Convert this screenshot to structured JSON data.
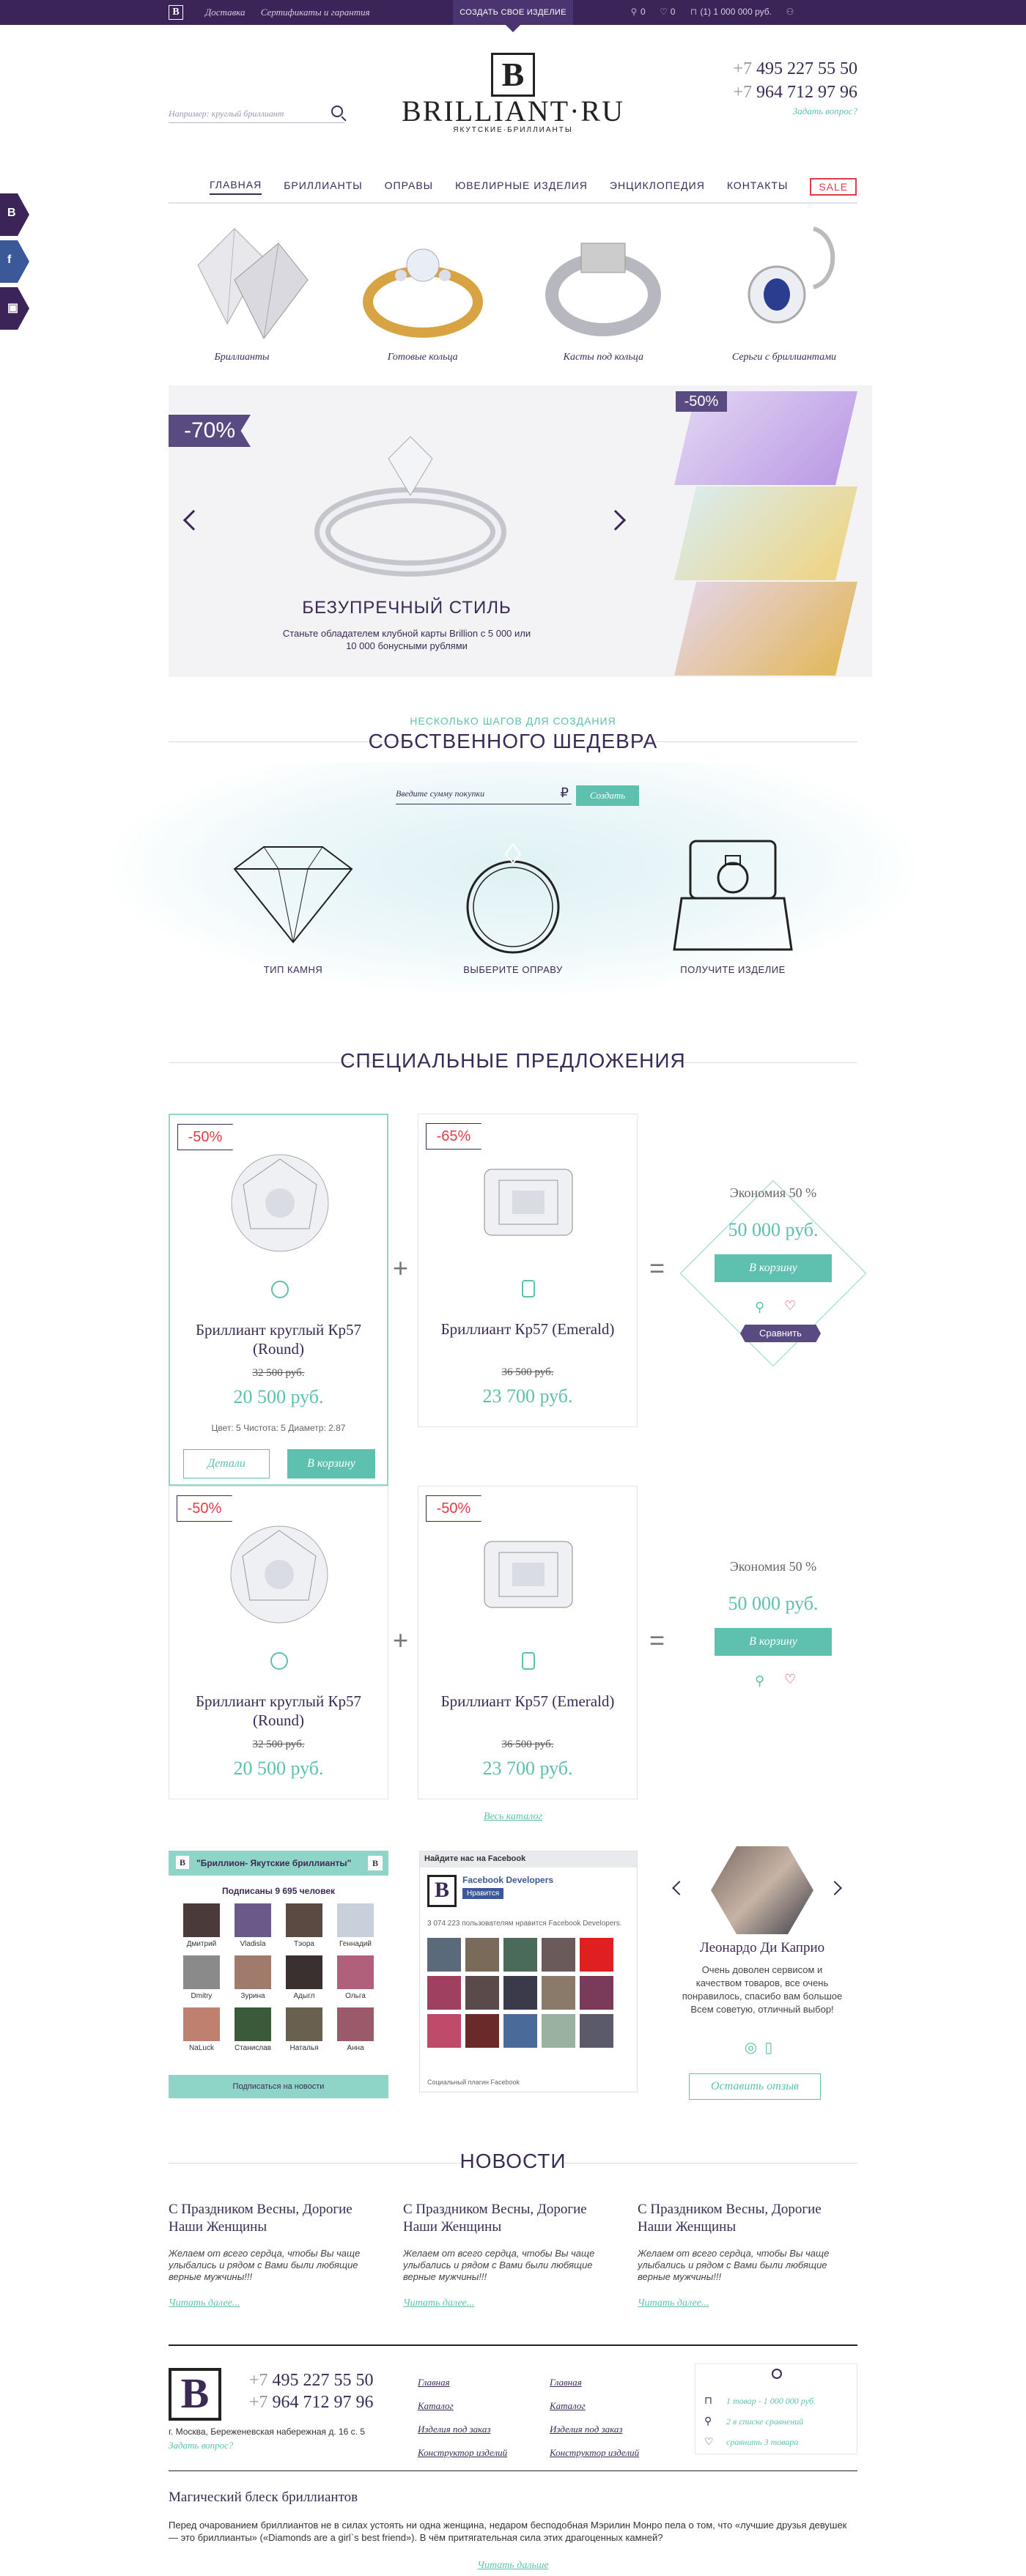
{
  "topbar": {
    "logo": "B",
    "links": [
      "Доставка",
      "Сертификаты и гарантия"
    ],
    "create": "СОЗДАТЬ СВОЕ ИЗДЕЛИЕ",
    "compare_count": "0",
    "fav_count": "0",
    "cart": "(1)   1 000 000 руб."
  },
  "header": {
    "search_placeholder": "Например: круглый бриллиант",
    "brand_mono": "B",
    "brand_name": "BRILLIANT·RU",
    "brand_tagline": "ЯКУТСКИЕ·БРИЛЛИАНТЫ",
    "phone1_prefix": "+7",
    "phone1": "495 227 55 50",
    "phone2_prefix": "+7",
    "phone2": "964 712 97 96",
    "ask": "Задать вопрос?"
  },
  "nav": [
    "ГЛАВНАЯ",
    "БРИЛЛИАНТЫ",
    "ОПРАВЫ",
    "ЮВЕЛИРНЫЕ ИЗДЕЛИЯ",
    "ЭНЦИКЛОПЕДИЯ",
    "КОНТАКТЫ",
    "SALE"
  ],
  "social": [
    "B",
    "f",
    "▣"
  ],
  "categories": [
    "Бриллианты",
    "Готовые кольца",
    "Касты под кольца",
    "Серьги с бриллиантами"
  ],
  "banner": {
    "badge": "-70%",
    "title": "БЕЗУПРЕЧНЫЙ СТИЛЬ",
    "subtitle": "Станьте обладателем клубной карты Brillion с 5 000 или 10 000 бонусными рублями",
    "side_badge": "-50%"
  },
  "steps": {
    "small": "НЕСКОЛЬКО ШАГОВ ДЛЯ СОЗДАНИЯ",
    "big": "СОБСТВЕННОГО ШЕДЕВРА",
    "input_placeholder": "Введите сумму покупки",
    "currency": "₽",
    "button": "Создать",
    "items": [
      "ТИП КАМНЯ",
      "ВЫБЕРИТЕ ОПРАВУ",
      "ПОЛУЧИТЕ ИЗДЕЛИЕ"
    ]
  },
  "specials": {
    "title": "СПЕЦИАЛЬНЫЕ ПРЕДЛОЖЕНИЯ",
    "rows": [
      {
        "a": {
          "disc": "-50%",
          "name": "Бриллиант круглый Кр57 (Round)",
          "old": "32 500 руб.",
          "new": "20 500 руб.",
          "spec": "Цвет: 5     Чистота: 5     Диаметр: 2.87",
          "details": "Детали",
          "cart": "В корзину"
        },
        "b": {
          "disc": "-65%",
          "name": "Бриллиант  Кр57 (Emerald)",
          "old": "36 500 руб.",
          "new": "23 700 руб."
        },
        "offer": {
          "eco": "Экономия 50 %",
          "price": "50 000 руб.",
          "button": "В корзину",
          "compare": "Сравнить"
        }
      },
      {
        "a": {
          "disc": "-50%",
          "name": "Бриллиант круглый Кр57 (Round)",
          "old": "32 500 руб.",
          "new": "20 500 руб."
        },
        "b": {
          "disc": "-50%",
          "name": "Бриллиант  Кр57 (Emerald)",
          "old": "36 500 руб.",
          "new": "23 700 руб."
        },
        "offer": {
          "eco": "Экономия 50 %",
          "price": "50 000 руб.",
          "button": "В корзину"
        }
      }
    ],
    "all": "Весь каталог"
  },
  "vk": {
    "title": "\"Бриллион- Якутские бриллианты\"",
    "count": "Подписаны 9 695 человек",
    "users": [
      "Дмитрий",
      "Vladisla",
      "Тэора",
      "Геннадий",
      "Dmitry",
      "Зурина",
      "Адыгл",
      "Ольга",
      "NaLuck",
      "Станислав",
      "Наталья",
      "Анна"
    ],
    "subscribe": "Подписаться на новости"
  },
  "fb": {
    "header": "Найдите нас на Facebook",
    "page": "Facebook Developers",
    "like": "Нравится",
    "text": "3 074 223 пользователям нравится Facebook Developers.",
    "footer": "Социальный плагин Facebook"
  },
  "review": {
    "name": "Леонардо Ди Каприо",
    "text": "Очень доволен сервисом и качеством товаров, все очень понравилось, спасибо вам большое Всем советую, отличный выбор!",
    "button": "Оставить отзыв"
  },
  "news": {
    "title": "НОВОСТИ",
    "items": [
      {
        "title": "С Праздником Весны, Дорогие Наши Женщины",
        "text": "Желаем от всего сердца, чтобы Вы чаще улыбались и рядом с Вами были любящие верные мужчины!!!",
        "more": "Читать далее..."
      },
      {
        "title": "С Праздником Весны, Дорогие Наши Женщины",
        "text": "Желаем от всего сердца, чтобы Вы чаще улыбались и рядом с Вами были любящие верные мужчины!!!",
        "more": "Читать далее..."
      },
      {
        "title": "С Праздником Весны, Дорогие Наши Женщины",
        "text": "Желаем от всего сердца, чтобы Вы чаще улыбались и рядом с Вами были любящие верные мужчины!!!",
        "more": "Читать далее..."
      }
    ]
  },
  "footer": {
    "mono": "B",
    "phone1_prefix": "+7",
    "phone1": "495 227 55 50",
    "phone2_prefix": "+7",
    "phone2": "964 712 97 96",
    "address": "г. Москва, Береженевская набережная д. 16 с. 5",
    "ask": "Задать вопрос?",
    "col1": [
      "Главная",
      "Каталог",
      "Изделия под заказ",
      "Конструктор изделий"
    ],
    "col2": [
      "Главная",
      "Каталог",
      "Изделия под заказ",
      "Конструктор изделий"
    ],
    "cart_line": "1 товар - 1 000 000 руб.",
    "compare_line": "2 в списке сравнений",
    "fav_line": "сравнить 3 товара"
  },
  "magic": {
    "title": "Магический блеск бриллиантов",
    "text": "Перед очарованием бриллиантов не в силах устоять ни одна женщина, недаром бесподобная Мэрилин Монро пела о том, что «лучшие друзья девушек — это бриллианты» («Diamonds are a girl`s best friend»). В чём притягательная сила этих драгоценных камней?",
    "more": "Читать дальше"
  }
}
